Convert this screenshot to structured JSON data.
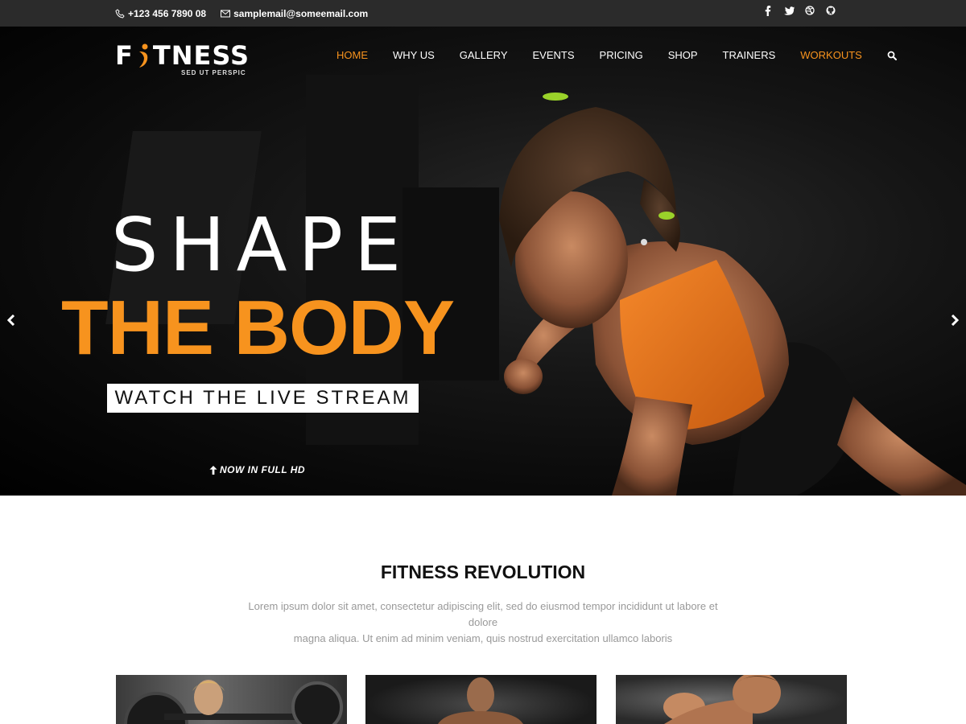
{
  "topbar": {
    "phone": "+123 456 7890 08",
    "email": "samplemail@someemail.com",
    "social": [
      "facebook-icon",
      "twitter-icon",
      "dribbble-icon",
      "github-icon"
    ]
  },
  "logo": {
    "text_left": "F",
    "text_right": "TNESS",
    "tagline": "SED UT PERSPIC"
  },
  "nav": {
    "items": [
      "HOME",
      "WHY US",
      "GALLERY",
      "EVENTS",
      "PRICING",
      "SHOP",
      "TRAINERS",
      "WORKOUTS"
    ],
    "active": "HOME"
  },
  "hero": {
    "line1": "SHAPE",
    "line2": "THE BODY",
    "button": "WATCH THE LIVE STREAM",
    "note": "NOW IN FULL HD"
  },
  "section": {
    "title": "FITNESS REVOLUTION",
    "desc_line1": "Lorem ipsum dolor sit amet, consectetur adipiscing elit, sed do eiusmod tempor incididunt ut labore et dolore",
    "desc_line2": "magna aliqua. Ut enim ad minim veniam, quis nostrud exercitation ullamco laboris"
  },
  "colors": {
    "accent": "#f7931e",
    "topbar": "#2b2b2b"
  }
}
